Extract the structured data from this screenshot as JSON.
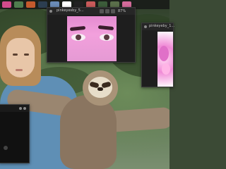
{
  "taskbar": {
    "icons": [
      {
        "name": "taskbar-app-icon-1",
        "color": "#d24b8c"
      },
      {
        "name": "taskbar-app-icon-2",
        "color": "#4f7d4e"
      },
      {
        "name": "taskbar-app-icon-3",
        "color": "#c45a2d"
      },
      {
        "name": "taskbar-app-icon-4",
        "color": "#2c3e50"
      },
      {
        "name": "taskbar-app-icon-5",
        "color": "#6a8bb6"
      },
      {
        "name": "taskbar-app-icon-6",
        "color": "#ffffff"
      },
      {
        "name": "taskbar-app-icon-7",
        "color": "#222222"
      },
      {
        "name": "taskbar-app-icon-8",
        "color": "#c85a5a"
      },
      {
        "name": "taskbar-app-icon-9",
        "color": "#3c5c3a"
      },
      {
        "name": "taskbar-app-icon-10",
        "color": "#5a6e4a"
      },
      {
        "name": "taskbar-app-icon-11",
        "color": "#d36a9a"
      }
    ]
  },
  "windows": {
    "eyes_viewer": {
      "title": "pinkeyesby_5...",
      "zoom": "87%"
    },
    "pink_viewer": {
      "title": "pinkeyeby_1..."
    },
    "dark_viewer": {
      "title": ""
    }
  },
  "colors": {
    "window_bg": "#1e1e1e",
    "titlebar_bg": "#262626",
    "accent_pink": "#e48bd0"
  }
}
